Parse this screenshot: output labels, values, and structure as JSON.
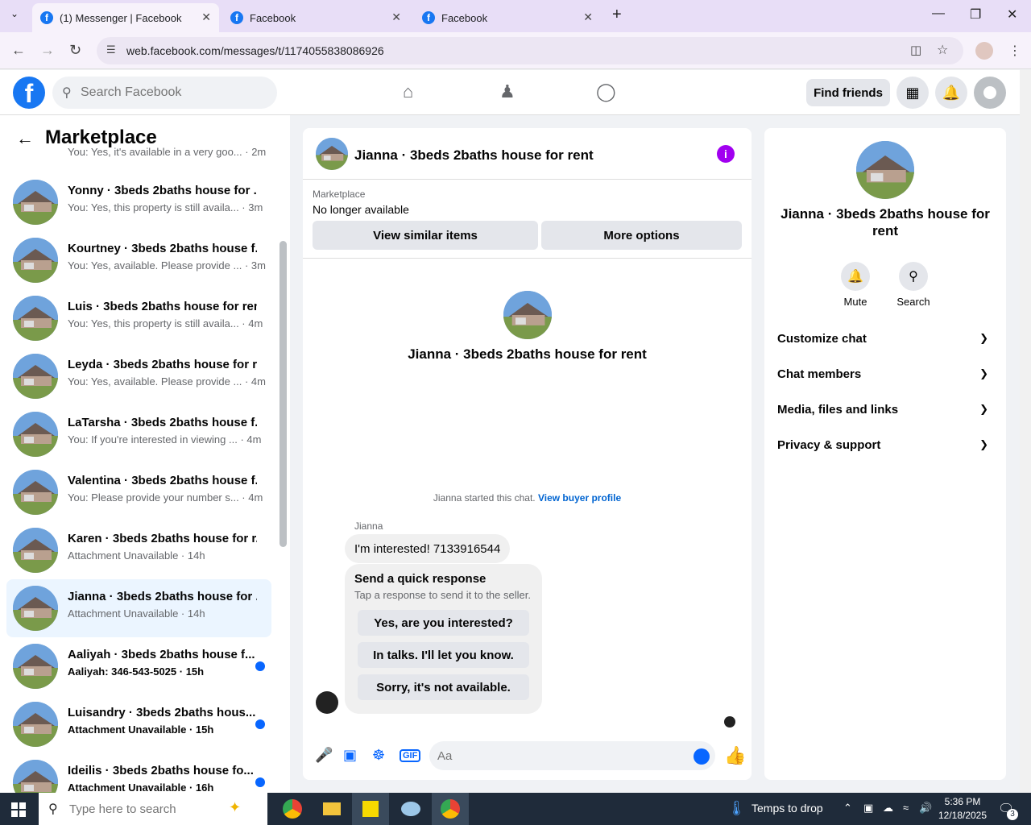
{
  "browser": {
    "tabs": [
      {
        "title": "(1) Messenger | Facebook",
        "active": true
      },
      {
        "title": "Facebook",
        "active": false
      },
      {
        "title": "Facebook",
        "active": false
      }
    ],
    "url": "web.facebook.com/messages/t/1174055838086926"
  },
  "header": {
    "search_placeholder": "Search Facebook",
    "find_friends": "Find friends"
  },
  "sidebar": {
    "title": "Marketplace",
    "partial_snippet": "You: Yes, it's available in a very goo... · 2m",
    "chats": [
      {
        "name": "Yonny · 3beds 2baths house for ...",
        "snippet": "You: Yes, this property is still availa... · 3m",
        "unread": false,
        "selected": false
      },
      {
        "name": "Kourtney · 3beds 2baths house f...",
        "snippet": "You: Yes, available. Please provide ... · 3m",
        "unread": false,
        "selected": false
      },
      {
        "name": "Luis · 3beds 2baths house for rent",
        "snippet": "You: Yes, this property is still availa... · 4m",
        "unread": false,
        "selected": false
      },
      {
        "name": "Leyda · 3beds 2baths house for r...",
        "snippet": "You: Yes, available. Please provide ... · 4m",
        "unread": false,
        "selected": false
      },
      {
        "name": "LaTarsha · 3beds 2baths house f...",
        "snippet": "You: If you're interested in viewing ... · 4m",
        "unread": false,
        "selected": false
      },
      {
        "name": "Valentina · 3beds 2baths house f...",
        "snippet": "You: Please provide your number s... · 4m",
        "unread": false,
        "selected": false
      },
      {
        "name": "Karen · 3beds 2baths house for r...",
        "snippet": "Attachment Unavailable · 14h",
        "unread": false,
        "selected": false
      },
      {
        "name": "Jianna · 3beds 2baths house for ...",
        "snippet": "Attachment Unavailable · 14h",
        "unread": false,
        "selected": true
      },
      {
        "name": "Aaliyah · 3beds 2baths house f...",
        "snippet": "Aaliyah: 346-543-5025 · 15h",
        "unread": true,
        "selected": false
      },
      {
        "name": "Luisandry · 3beds 2baths hous...",
        "snippet": "Attachment Unavailable · 15h",
        "unread": true,
        "selected": false
      },
      {
        "name": "Ideilis · 3beds 2baths house fo...",
        "snippet": "Attachment Unavailable · 16h",
        "unread": true,
        "selected": false
      }
    ]
  },
  "chat": {
    "title": "Jianna · 3beds 2baths house for rent",
    "marketplace_label": "Marketplace",
    "status": "No longer available",
    "view_similar": "View similar items",
    "more_options": "More options",
    "intro_name": "Jianna · 3beds 2baths house for rent",
    "started_text": "Jianna started this chat.",
    "buyer_profile_link": "View buyer profile",
    "sender": "Jianna",
    "message": "I'm interested! 7133916544",
    "quick_title": "Send a quick response",
    "quick_sub": "Tap a response to send it to the seller.",
    "quick_responses": [
      "Yes, are you interested?",
      "In talks. I'll let you know.",
      "Sorry, it's not available."
    ],
    "input_placeholder": "Aa"
  },
  "info": {
    "name": "Jianna · 3beds 2baths house for rent",
    "mute": "Mute",
    "search": "Search",
    "sections": [
      "Customize chat",
      "Chat members",
      "Media, files and links",
      "Privacy & support"
    ]
  },
  "taskbar": {
    "search_placeholder": "Type here to search",
    "weather": "Temps to drop",
    "time": "5:36 PM",
    "date": "12/18/2025",
    "notification_count": "3"
  },
  "colors": {
    "fb_blue": "#1877f2",
    "messenger_blue": "#0866ff",
    "info_purple": "#a100f0"
  }
}
